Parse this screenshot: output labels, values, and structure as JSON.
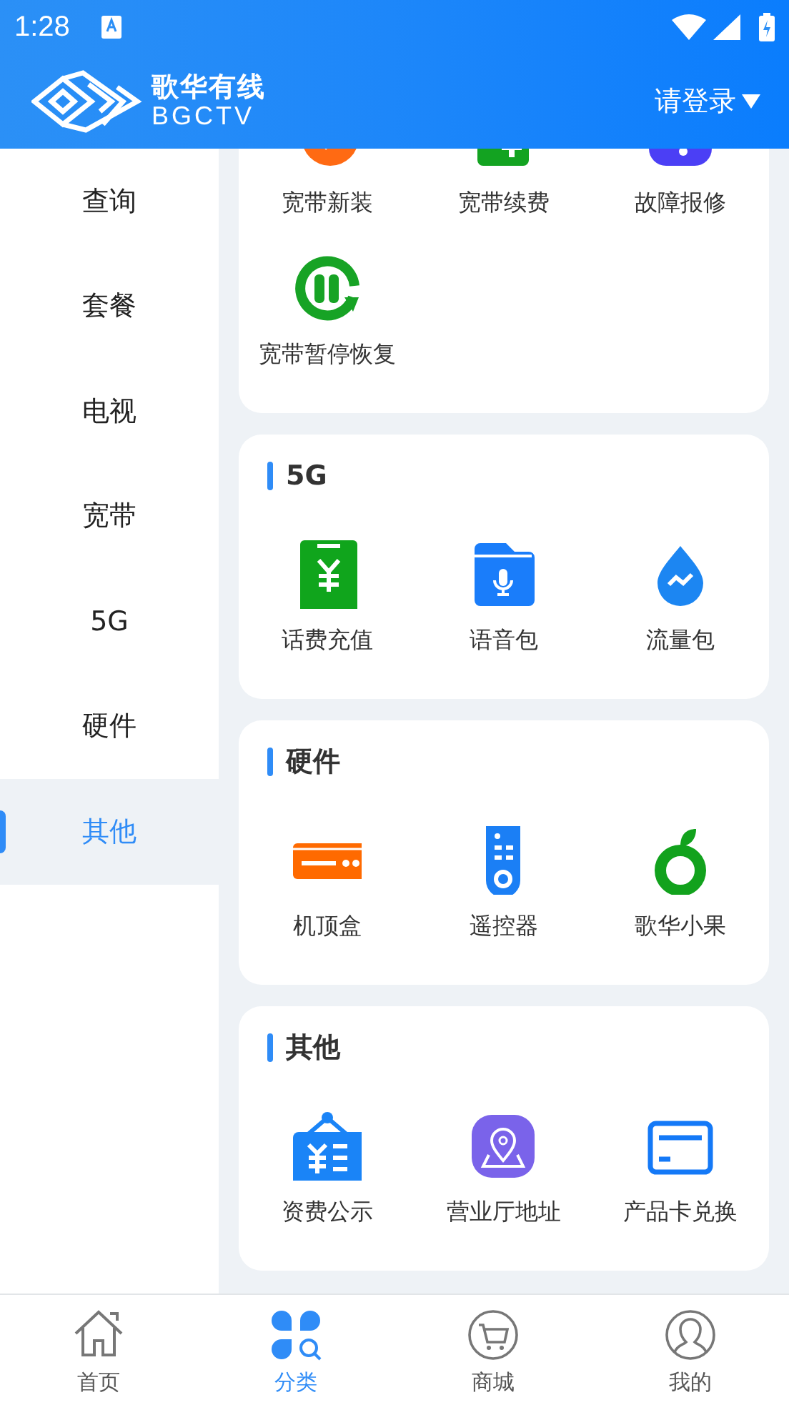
{
  "status_bar": {
    "time": "1:28"
  },
  "header": {
    "brand_name": "歌华有线",
    "brand_latin": "BGCTV",
    "login": "请登录"
  },
  "sidebar": {
    "items": [
      {
        "label": "查询",
        "selected": false
      },
      {
        "label": "套餐",
        "selected": false
      },
      {
        "label": "电视",
        "selected": false
      },
      {
        "label": "宽带",
        "selected": false
      },
      {
        "label": "5G",
        "selected": false
      },
      {
        "label": "硬件",
        "selected": false
      },
      {
        "label": "其他",
        "selected": true
      }
    ]
  },
  "sections": [
    {
      "items": [
        {
          "label": "宽带新装",
          "kind": "badge"
        },
        {
          "label": "宽带续费",
          "kind": "renew"
        },
        {
          "label": "故障报修",
          "kind": "repair"
        },
        {
          "label": "宽带暂停恢复",
          "kind": "pause"
        }
      ]
    },
    {
      "title": "5G",
      "items": [
        {
          "label": "话费充值",
          "kind": "topup"
        },
        {
          "label": "语音包",
          "kind": "voice"
        },
        {
          "label": "流量包",
          "kind": "data"
        }
      ]
    },
    {
      "title": "硬件",
      "items": [
        {
          "label": "机顶盒",
          "kind": "settop"
        },
        {
          "label": "遥控器",
          "kind": "remote"
        },
        {
          "label": "歌华小果",
          "kind": "fruit"
        }
      ]
    },
    {
      "title": "其他",
      "items": [
        {
          "label": "资费公示",
          "kind": "tariff"
        },
        {
          "label": "营业厅地址",
          "kind": "location"
        },
        {
          "label": "产品卡兑换",
          "kind": "card"
        }
      ]
    }
  ],
  "bottom_nav": {
    "items": [
      {
        "label": "首页",
        "kind": "home",
        "selected": false
      },
      {
        "label": "分类",
        "kind": "category",
        "selected": true
      },
      {
        "label": "商城",
        "kind": "cart",
        "selected": false
      },
      {
        "label": "我的",
        "kind": "user",
        "selected": false
      }
    ]
  }
}
